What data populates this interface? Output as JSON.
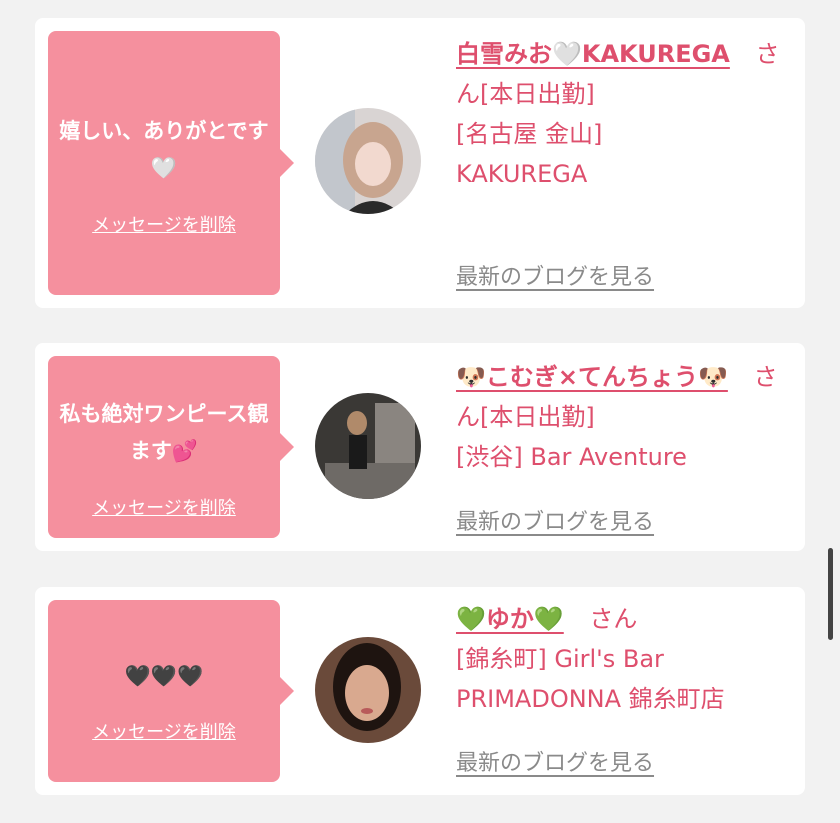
{
  "cards": [
    {
      "message": "嬉しい、ありがとです🤍",
      "delete_label": "メッセージを削除",
      "name": "白雪みお🤍KAKUREGA",
      "suffix": "さん[本日出勤]",
      "shop": "[名古屋 金山] KAKUREGA",
      "blog_label": "最新のブログを見る"
    },
    {
      "message": "私も絶対ワンピース観ます💕",
      "delete_label": "メッセージを削除",
      "name": "🐶こむぎ×てんちょう🐶",
      "suffix": "さん[本日出勤]",
      "shop": "[渋谷] Bar Aventure",
      "blog_label": "最新のブログを見る"
    },
    {
      "message": "🖤🖤🖤",
      "delete_label": "メッセージを削除",
      "name": "💚ゆか💚",
      "suffix": "さん",
      "shop": "[錦糸町] Girl's Bar PRIMADONNA 錦糸町店",
      "blog_label": "最新のブログを見る"
    }
  ],
  "colors": {
    "bubble": "#f5909e",
    "accent": "#de4f6d",
    "link_gray": "#8a8a8a",
    "background": "#f2f2f2"
  }
}
